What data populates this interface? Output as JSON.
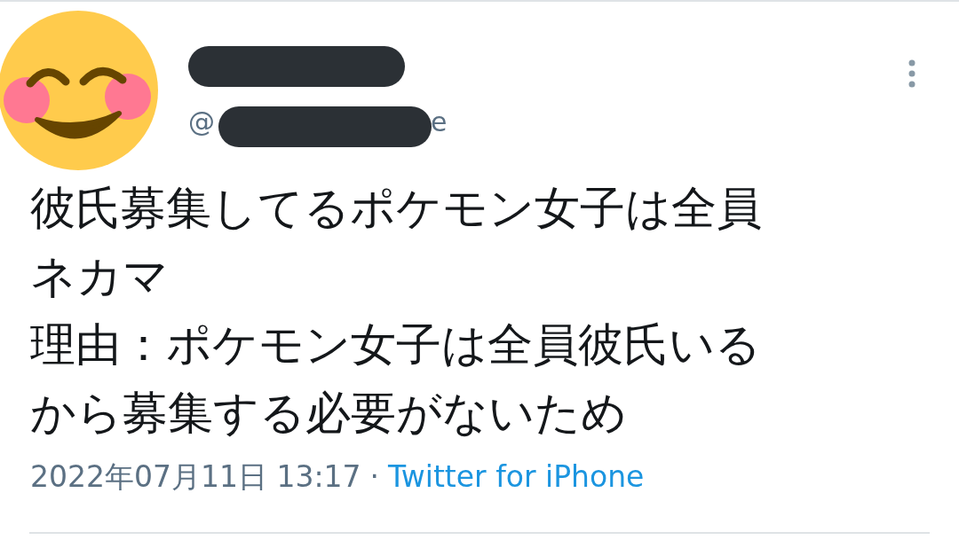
{
  "tweet": {
    "handle_start": "@",
    "handle_end": "e",
    "body_lines": [
      "彼氏募集してるポケモン女子は全員",
      "ネカマ",
      "理由：ポケモン女子は全員彼氏いる",
      "から募集する必要がないため"
    ],
    "timestamp": "2022年07月11日 13:17",
    "separator": "·",
    "source": "Twitter for iPhone"
  }
}
